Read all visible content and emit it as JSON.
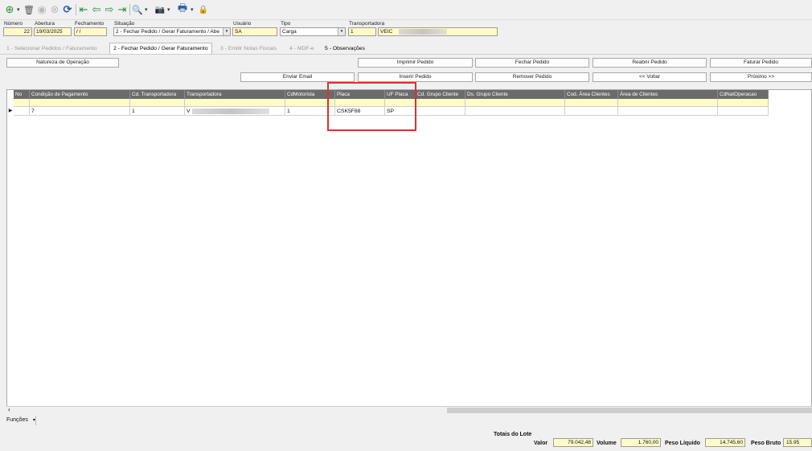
{
  "toolbar": {
    "icons": [
      "add-circle-icon",
      "trash-icon",
      "disabled-circle-icon",
      "cancel-circle-icon",
      "refresh-icon",
      "first-record-icon",
      "back-arrow-icon",
      "forward-arrow-icon",
      "last-record-icon",
      "search-icon",
      "camera-icon",
      "printer-icon",
      "lock-icon"
    ],
    "glyphs": {
      "add": "⊕",
      "trash": "🗑",
      "disabled": "◉",
      "cancel": "⊗",
      "refresh": "⟳",
      "first": "⇤",
      "back": "⇦",
      "forward": "⇨",
      "last": "⇥",
      "search": "🔍",
      "camera": "📷",
      "printer": "🖶",
      "lock": "🔒"
    },
    "caret": "▾"
  },
  "header": {
    "numero_label": "Número",
    "numero_value": "22",
    "abertura_label": "Abertura",
    "abertura_value": "19/03/2025",
    "fechamento_label": "Fechamento",
    "fechamento_value": "/ /",
    "situacao_label": "Situação",
    "situacao_value": "2 - Fechar Pedido / Gerar Faturamento / Abe",
    "usuario_label": "Usuário",
    "usuario_value": "SA",
    "tipo_label": "Tipo",
    "tipo_value": "Carga",
    "transportadora_label": "Transportadora",
    "transportadora_code": "1",
    "transportadora_name": "VEIC",
    "combo_arrow": "▾"
  },
  "tabs": [
    {
      "label": "1 - Selecionar Pedidos / Faturamento",
      "state": "disabled"
    },
    {
      "label": "2 - Fechar Pedido / Gerar Faturamento",
      "state": "active"
    },
    {
      "label": "3 - Emitir Notas Fiscais",
      "state": "disabled"
    },
    {
      "label": "4 - MDF-e",
      "state": "disabled"
    },
    {
      "label": "5 - Observações",
      "state": "enabled"
    }
  ],
  "buttons": {
    "natureza": "Natureza de Operação",
    "imprimir": "Imprimir Pedido",
    "fechar": "Fechar Pedido",
    "reabrir": "Reabrir Pedido",
    "faturar": "Faturar Pedido",
    "enviar_email": "Enviar Email",
    "inserir": "Inserir Pedido",
    "remover": "Remover Pedido",
    "voltar": "<< Voltar",
    "proximo": "Próximo >>"
  },
  "grid": {
    "columns": [
      "No",
      "Condição de Pagamento",
      "Cd. Transportadora",
      "Transportadora",
      "CdMotorista",
      "Placa",
      "UF Placa",
      "Cd. Grupo Cliente",
      "Ds. Grupo Cliente",
      "Cod. Área Clientes",
      "Área de Clientes",
      "CdNatOperacao"
    ],
    "row": [
      "",
      "7",
      "1",
      "V",
      "1",
      "CSK5F88",
      "SP",
      "",
      "",
      "",
      "",
      ""
    ],
    "row_indicator": "▶",
    "scroll_left": "‹"
  },
  "footer": {
    "funcoes_label": "Funções",
    "funcoes_caret": "▾",
    "totais_label": "Totais do Lote",
    "valor_label": "Valor",
    "valor_value": "79.042,48",
    "volume_label": "Volume",
    "volume_value": "1.760,00",
    "peso_liquido_label": "Peso Líquido",
    "peso_liquido_value": "14.745,60",
    "peso_bruto_label": "Peso Bruto",
    "peso_bruto_value": "15.95"
  },
  "colors": {
    "field_yellow": "#fffbc8",
    "grid_header": "#6b6b6b",
    "highlight_red": "#e03030",
    "toolbar_blue": "#2b5fa8",
    "toolbar_green": "#2f8f3a"
  }
}
